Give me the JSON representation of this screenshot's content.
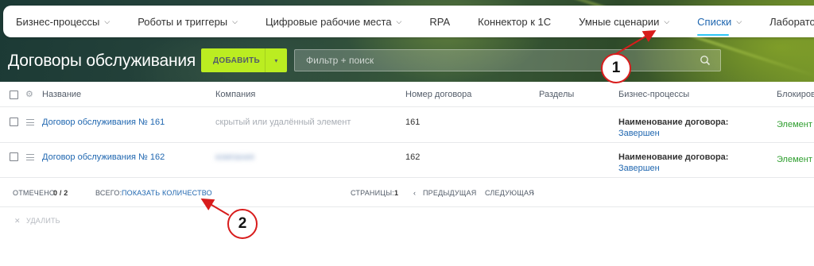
{
  "topnav": {
    "items": [
      {
        "label": "Бизнес-процессы",
        "chevron": true
      },
      {
        "label": "Роботы и триггеры",
        "chevron": true
      },
      {
        "label": "Цифровые рабочие места",
        "chevron": true
      },
      {
        "label": "RPA",
        "chevron": false
      },
      {
        "label": "Коннектор к 1С",
        "chevron": false
      },
      {
        "label": "Умные сценарии",
        "chevron": true
      },
      {
        "label": "Списки",
        "chevron": true,
        "active": true
      },
      {
        "label": "Лаборатория AI",
        "chevron": false
      }
    ]
  },
  "toolbar": {
    "title": "Договоры обслуживания",
    "add_label": "ДОБАВИТЬ",
    "filter_placeholder": "Фильтр + поиск"
  },
  "grid": {
    "columns": [
      "Название",
      "Компания",
      "Номер договора",
      "Разделы",
      "Бизнес-процессы",
      "Блокиров"
    ],
    "rows": [
      {
        "name": "Договор обслуживания № 161",
        "company": "скрытый или удалённый элемент",
        "number": "161",
        "section": "",
        "bp_title": "Наименование договора:",
        "bp_status": "Завершен",
        "lock": "Элемент"
      },
      {
        "name": "Договор обслуживания № 162",
        "company": "компания",
        "number": "162",
        "section": "",
        "bp_title": "Наименование договора:",
        "bp_status": "Завершен",
        "lock": "Элемент"
      }
    ]
  },
  "footer": {
    "marked_label": "ОТМЕЧЕНО:",
    "marked_value": "0 / 2",
    "total_label": "ВСЕГО:",
    "total_link": "ПОКАЗАТЬ КОЛИЧЕСТВО",
    "pages_label": "СТРАНИЦЫ:",
    "page_number": "1",
    "prev_label": "ПРЕДЫДУЩАЯ",
    "next_label": "СЛЕДУЮЩАЯ"
  },
  "actions": {
    "delete_label": "УДАЛИТЬ"
  },
  "annotations": {
    "callout_1": "1",
    "callout_2": "2"
  },
  "colors": {
    "accent": "#2067b0",
    "add_button": "#bbed21",
    "annotation": "#d81c1c"
  }
}
